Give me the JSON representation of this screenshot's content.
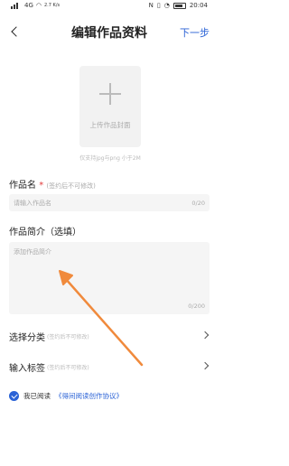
{
  "status": {
    "carrier": "4G",
    "speed": "2.7 K/s",
    "time": "20:04"
  },
  "header": {
    "title": "编辑作品资料",
    "next_label": "下一步"
  },
  "cover": {
    "upload_label": "上传作品封面",
    "hint": "仅支持jpg与png 小于2M"
  },
  "name_field": {
    "label": "作品名",
    "required_mark": "*",
    "note": "(签约后不可修改)",
    "placeholder": "请输入作品名",
    "counter": "0/20"
  },
  "intro_field": {
    "label": "作品简介（选填）",
    "placeholder": "添加作品简介",
    "counter": "0/200"
  },
  "category": {
    "label": "选择分类",
    "note": "(签约后不可修改)"
  },
  "tags": {
    "label": "输入标签",
    "note": "(签约后不可修改)"
  },
  "agreement": {
    "prefix": "我已阅读",
    "link": "《得间阅读创作协议》"
  },
  "colors": {
    "accent": "#2a62d6",
    "arrow": "#f08a3c",
    "required": "#e23a3a"
  }
}
